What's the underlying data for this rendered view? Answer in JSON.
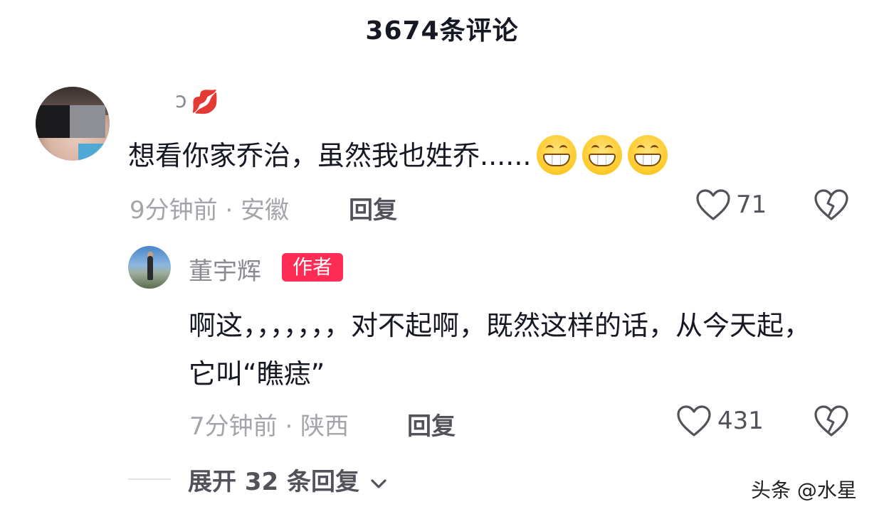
{
  "header": {
    "title": "3674条评论"
  },
  "comments": [
    {
      "username": "ɔ",
      "username_emoji": "💋",
      "text": "想看你家乔治，虽然我也姓乔......",
      "emojis": [
        "grinning-face-icon",
        "grinning-face-icon",
        "grinning-face-icon"
      ],
      "meta": "9分钟前 · 安徽",
      "reply_label": "回复",
      "likes": "71",
      "reply": {
        "username": "董宇辉",
        "badge": "作者",
        "text": "啊这，，，，，，，对不起啊，既然这样的话，从今天起，它叫“瞧痣”",
        "meta": "7分钟前 · 陕西",
        "reply_label": "回复",
        "likes": "431"
      }
    }
  ],
  "expand": {
    "label": "展开 32 条回复"
  },
  "watermark": "头条 @水星",
  "colors": {
    "accent": "#fe2c55",
    "text": "#161823",
    "muted": "#a4a5aa"
  }
}
